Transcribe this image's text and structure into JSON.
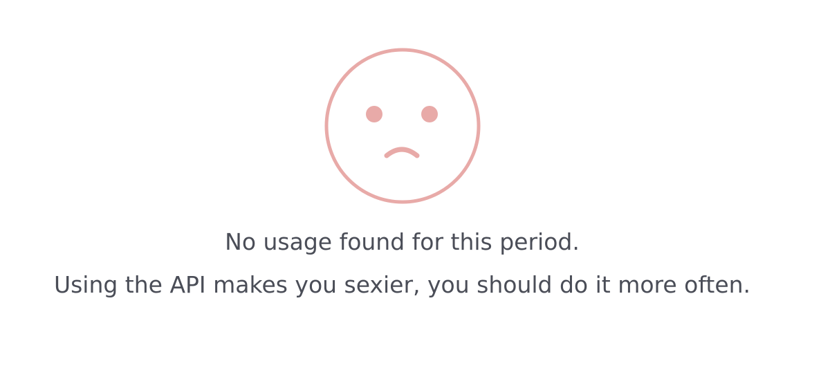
{
  "empty_state": {
    "icon": "sad-face-icon",
    "icon_color": "#e8aaa8",
    "text_color": "#4a4d57",
    "message_primary": "No usage found for this period.",
    "message_secondary": "Using the API makes you sexier, you should do it more often."
  }
}
